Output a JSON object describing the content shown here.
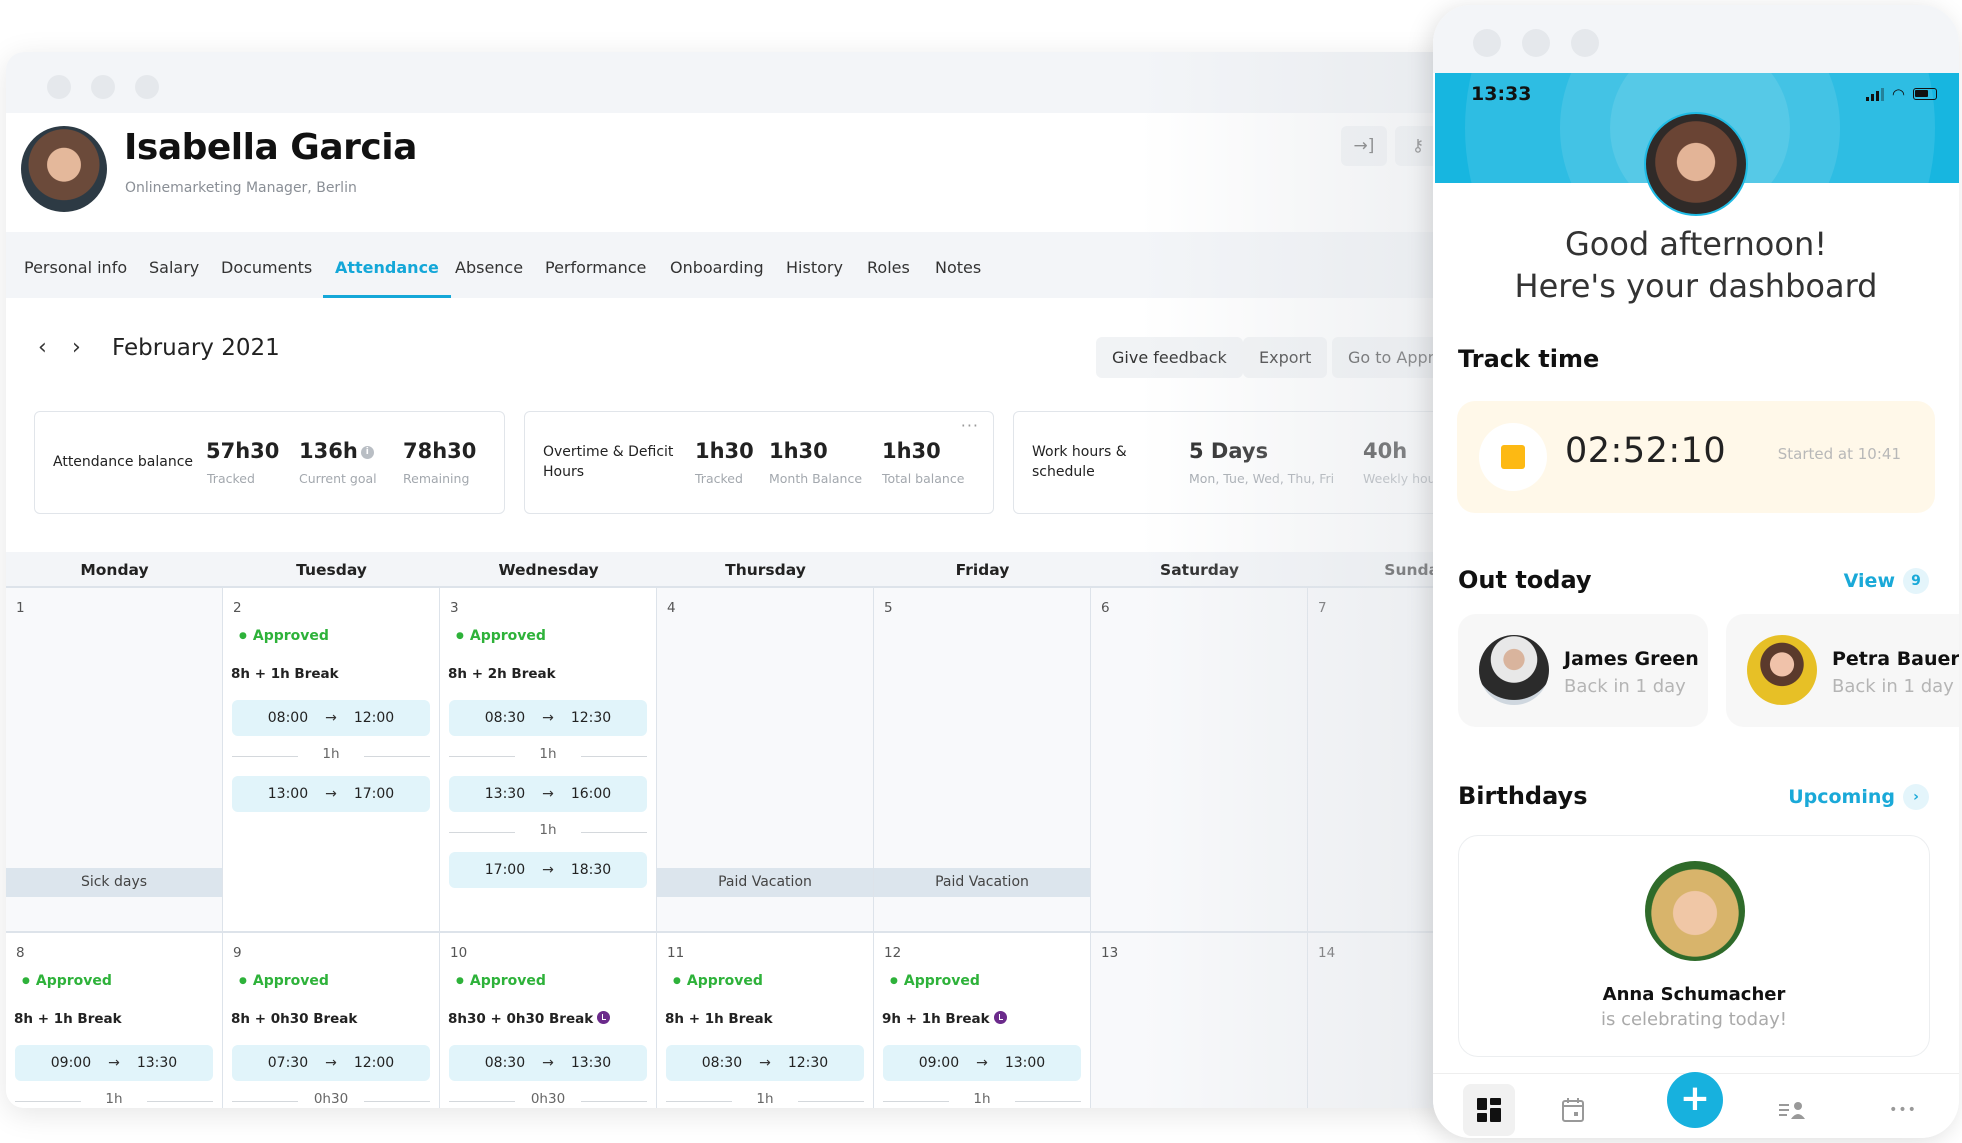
{
  "desktop": {
    "employee": {
      "name": "Isabella Garcia",
      "subtitle": "Onlinemarketing Manager, Berlin"
    },
    "header_actions": [
      {
        "icon": "login-arrow-icon",
        "glyph": "→]"
      },
      {
        "icon": "key-icon",
        "glyph": "⚷"
      }
    ],
    "tabs": [
      {
        "label": "Personal info",
        "active": false
      },
      {
        "label": "Salary",
        "active": false
      },
      {
        "label": "Documents",
        "active": false
      },
      {
        "label": "Attendance",
        "active": true
      },
      {
        "label": "Absence",
        "active": false
      },
      {
        "label": "Performance",
        "active": false
      },
      {
        "label": "Onboarding",
        "active": false
      },
      {
        "label": "History",
        "active": false
      },
      {
        "label": "Roles",
        "active": false
      },
      {
        "label": "Notes",
        "active": false
      }
    ],
    "month": {
      "prev_glyph": "‹",
      "next_glyph": "›",
      "label": "February 2021"
    },
    "buttons": {
      "feedback": "Give feedback",
      "export": "Export",
      "approvals": "Go to Approvals"
    },
    "stats": [
      {
        "title": "Attendance balance",
        "items": [
          {
            "value": "57h30",
            "label": "Tracked"
          },
          {
            "value": "136h",
            "label": "Current goal",
            "info": true
          },
          {
            "value": "78h30",
            "label": "Remaining"
          }
        ]
      },
      {
        "title": "Overtime & Deficit Hours",
        "more": "···",
        "items": [
          {
            "value": "1h30",
            "label": "Tracked"
          },
          {
            "value": "1h30",
            "label": "Month Balance"
          },
          {
            "value": "1h30",
            "label": "Total balance"
          }
        ]
      },
      {
        "title": "Work hours & schedule",
        "items": [
          {
            "value": "5 Days",
            "label": "Mon, Tue, Wed, Thu, Fri"
          },
          {
            "value": "40h",
            "label": "Weekly hours"
          }
        ]
      }
    ],
    "calendar": {
      "weekdays": [
        "Monday",
        "Tuesday",
        "Wednesday",
        "Thursday",
        "Friday",
        "Saturday",
        "Sunday"
      ],
      "approved_label": "Approved",
      "week1": [
        {
          "day": "1",
          "absence": "Sick days"
        },
        {
          "day": "2",
          "status": "Approved",
          "schedule": "8h + 1h Break",
          "slots": [
            {
              "from": "08:00",
              "to": "12:00"
            },
            {
              "from": "13:00",
              "to": "17:00"
            }
          ],
          "breaks": [
            "1h"
          ]
        },
        {
          "day": "3",
          "status": "Approved",
          "schedule": "8h + 2h Break",
          "slots": [
            {
              "from": "08:30",
              "to": "12:30"
            },
            {
              "from": "13:30",
              "to": "16:00"
            },
            {
              "from": "17:00",
              "to": "18:30"
            }
          ],
          "breaks": [
            "1h",
            "1h"
          ]
        },
        {
          "day": "4",
          "absence": "Paid Vacation"
        },
        {
          "day": "5",
          "absence": "Paid Vacation"
        },
        {
          "day": "6"
        },
        {
          "day": "7"
        }
      ],
      "week2": [
        {
          "day": "8",
          "status": "Approved",
          "schedule": "8h + 1h Break",
          "slots": [
            {
              "from": "09:00",
              "to": "13:30"
            }
          ],
          "breaks": [
            "1h"
          ]
        },
        {
          "day": "9",
          "status": "Approved",
          "schedule": "8h + 0h30 Break",
          "slots": [
            {
              "from": "07:30",
              "to": "12:00"
            }
          ],
          "breaks": [
            "0h30"
          ]
        },
        {
          "day": "10",
          "status": "Approved",
          "schedule": "8h30 + 0h30 Break",
          "overtime_icon": true,
          "slots": [
            {
              "from": "08:30",
              "to": "13:30"
            }
          ],
          "breaks": [
            "0h30"
          ]
        },
        {
          "day": "11",
          "status": "Approved",
          "schedule": "8h + 1h Break",
          "slots": [
            {
              "from": "08:30",
              "to": "12:30"
            }
          ],
          "breaks": [
            "1h"
          ]
        },
        {
          "day": "12",
          "status": "Approved",
          "schedule": "9h + 1h Break",
          "overtime_icon": true,
          "slots": [
            {
              "from": "09:00",
              "to": "13:00"
            }
          ],
          "breaks": [
            "1h"
          ]
        },
        {
          "day": "13"
        },
        {
          "day": "14"
        }
      ],
      "arrow_glyph": "→"
    }
  },
  "phone": {
    "status_time": "13:33",
    "greeting_line1": "Good afternoon!",
    "greeting_line2": "Here's your dashboard",
    "track": {
      "title": "Track time",
      "timer": "02:52:10",
      "started": "Started at 10:41"
    },
    "out_today": {
      "title": "Out today",
      "link": "View",
      "count": "9",
      "people": [
        {
          "name": "James Green",
          "sub": "Back in 1 day"
        },
        {
          "name": "Petra Bauer",
          "sub": "Back in 1 day"
        }
      ]
    },
    "birthdays": {
      "title": "Birthdays",
      "link": "Upcoming",
      "link_glyph": "›",
      "name": "Anna Schumacher",
      "sub": "is celebrating today!"
    },
    "tabbar": {
      "add_glyph": "+",
      "more_glyph": "•••"
    },
    "colors": {
      "brand_blue": "#17b6e0",
      "approved_green": "#2eb23a",
      "overtime_purple": "#6b2a8b",
      "timer_yellow": "#fdb913"
    }
  }
}
